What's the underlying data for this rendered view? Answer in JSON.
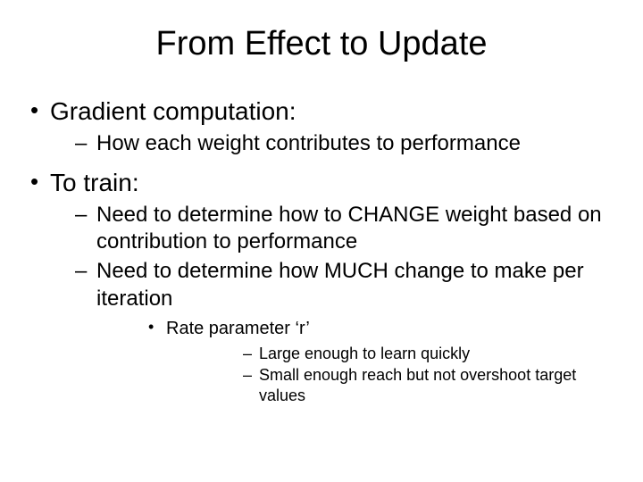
{
  "title": "From Effect to Update",
  "bullets": {
    "b1": "Gradient computation:",
    "b1_1": "How each weight contributes to performance",
    "b2": "To train:",
    "b2_1": "Need to determine how to CHANGE weight based on contribution to performance",
    "b2_2": "Need to determine how MUCH change to make per iteration",
    "b2_2_1": "Rate parameter  ‘r’",
    "b2_2_1_1": "Large enough to learn quickly",
    "b2_2_1_2": "Small enough reach but not overshoot target values"
  }
}
